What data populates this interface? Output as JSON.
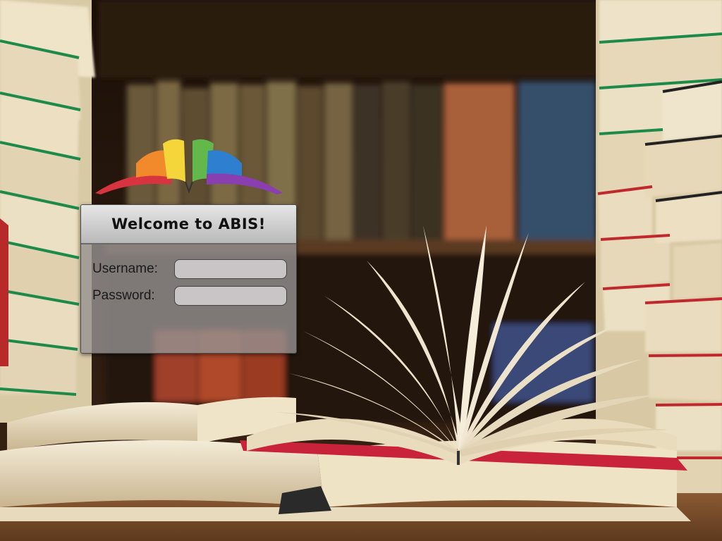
{
  "app": {
    "logo_name": "abis-open-book-logo",
    "welcome_title": "Welcome to ABIS!"
  },
  "login": {
    "username_label": "Username:",
    "password_label": "Password:",
    "username_value": "",
    "password_value": ""
  },
  "background": {
    "description_icon": "library-books-background"
  },
  "colors": {
    "panel_header": "#d2d2d2",
    "panel_body": "#969292",
    "input_fill": "#c9c5c6",
    "logo_red": "#d8343f",
    "logo_orange": "#f08a2a",
    "logo_yellow": "#f5d63a",
    "logo_green": "#62b94a",
    "logo_blue": "#2f7fd0",
    "logo_purple": "#8a3fb0"
  }
}
